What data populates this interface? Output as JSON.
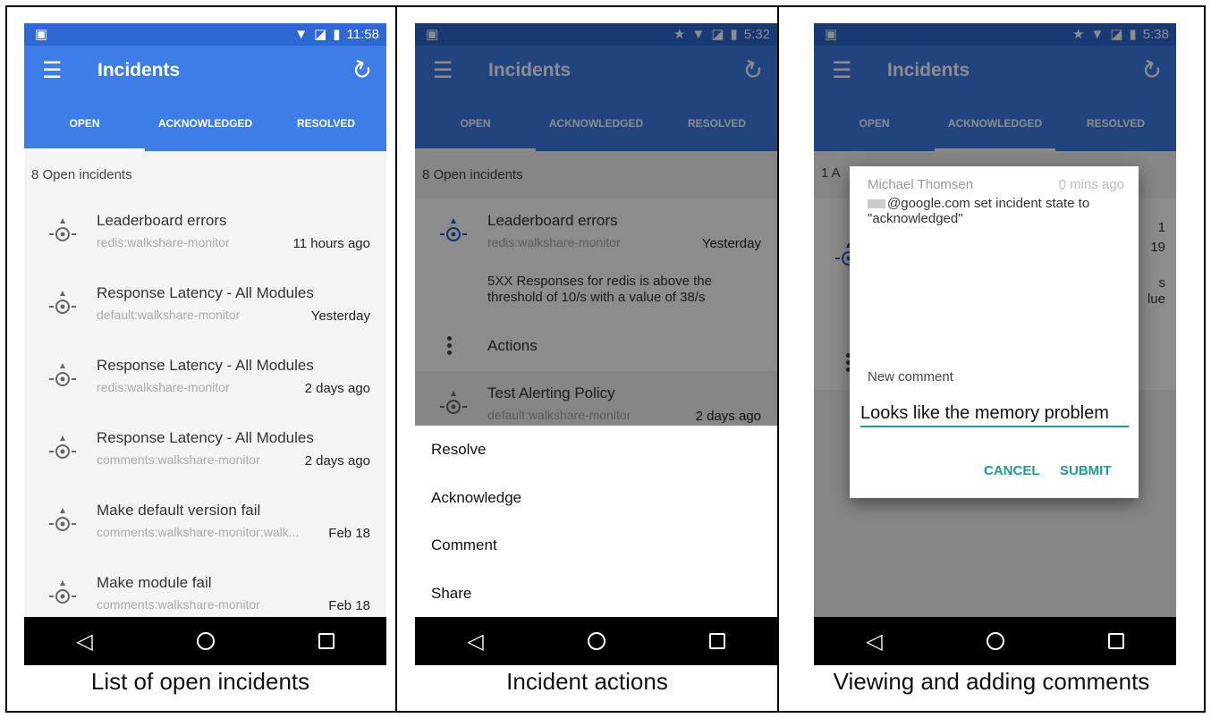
{
  "colors": {
    "primary": "#3d7de8",
    "primary_dark": "#2e68d3",
    "accent": "#1a9f8f"
  },
  "captions": [
    "List of open incidents",
    "Incident actions",
    "Viewing and adding comments"
  ],
  "phones": [
    {
      "time": "11:58",
      "app_title": "Incidents",
      "tabs": [
        "OPEN",
        "ACKNOWLEDGED",
        "RESOLVED"
      ],
      "active_tab": 0,
      "summary": "8 Open incidents",
      "incidents": [
        {
          "title": "Leaderboard errors",
          "source": "redis:walkshare-monitor",
          "time": "11 hours ago"
        },
        {
          "title": "Response Latency - All Modules",
          "source": "default:walkshare-monitor",
          "time": "Yesterday"
        },
        {
          "title": "Response Latency - All Modules",
          "source": "redis:walkshare-monitor",
          "time": "2 days ago"
        },
        {
          "title": "Response Latency - All Modules",
          "source": "comments:walkshare-monitor",
          "time": "2 days ago"
        },
        {
          "title": "Make default version fail",
          "source": "comments:walkshare-monitor:walk...",
          "time": "Feb 18"
        },
        {
          "title": "Make module fail",
          "source": "comments:walkshare-monitor",
          "time": "Feb 18"
        }
      ]
    },
    {
      "time": "5:32",
      "app_title": "Incidents",
      "tabs": [
        "OPEN",
        "ACKNOWLEDGED",
        "RESOLVED"
      ],
      "active_tab": 0,
      "summary": "8 Open incidents",
      "incident": {
        "title": "Leaderboard errors",
        "source": "redis:walkshare-monitor",
        "time": "Yesterday",
        "detail_line1": "5XX Responses for redis is above the",
        "detail_line2": "threshold of 10/s with a value of 38/s",
        "actions_label": "Actions"
      },
      "next_incident": {
        "title": "Test Alerting Policy",
        "source": "default:walkshare-monitor",
        "time": "2 days ago"
      },
      "sheet_items": [
        "Resolve",
        "Acknowledge",
        "Comment",
        "Share"
      ]
    },
    {
      "time": "5:38",
      "app_title": "Incidents",
      "tabs": [
        "OPEN",
        "ACKNOWLEDGED",
        "RESOLVED"
      ],
      "active_tab": 1,
      "summary_peek": "1 A",
      "peek_right": [
        "1",
        "19",
        "s",
        "lue"
      ],
      "dialog": {
        "author": "Michael Thomsen",
        "time": "0 mins ago",
        "text_line1": "@google.com set incident state to",
        "text_line2": "\"acknowledged\"",
        "new_comment_label": "New comment",
        "input_value": "Looks like the memory problem",
        "cancel": "CANCEL",
        "submit": "SUBMIT"
      }
    }
  ]
}
